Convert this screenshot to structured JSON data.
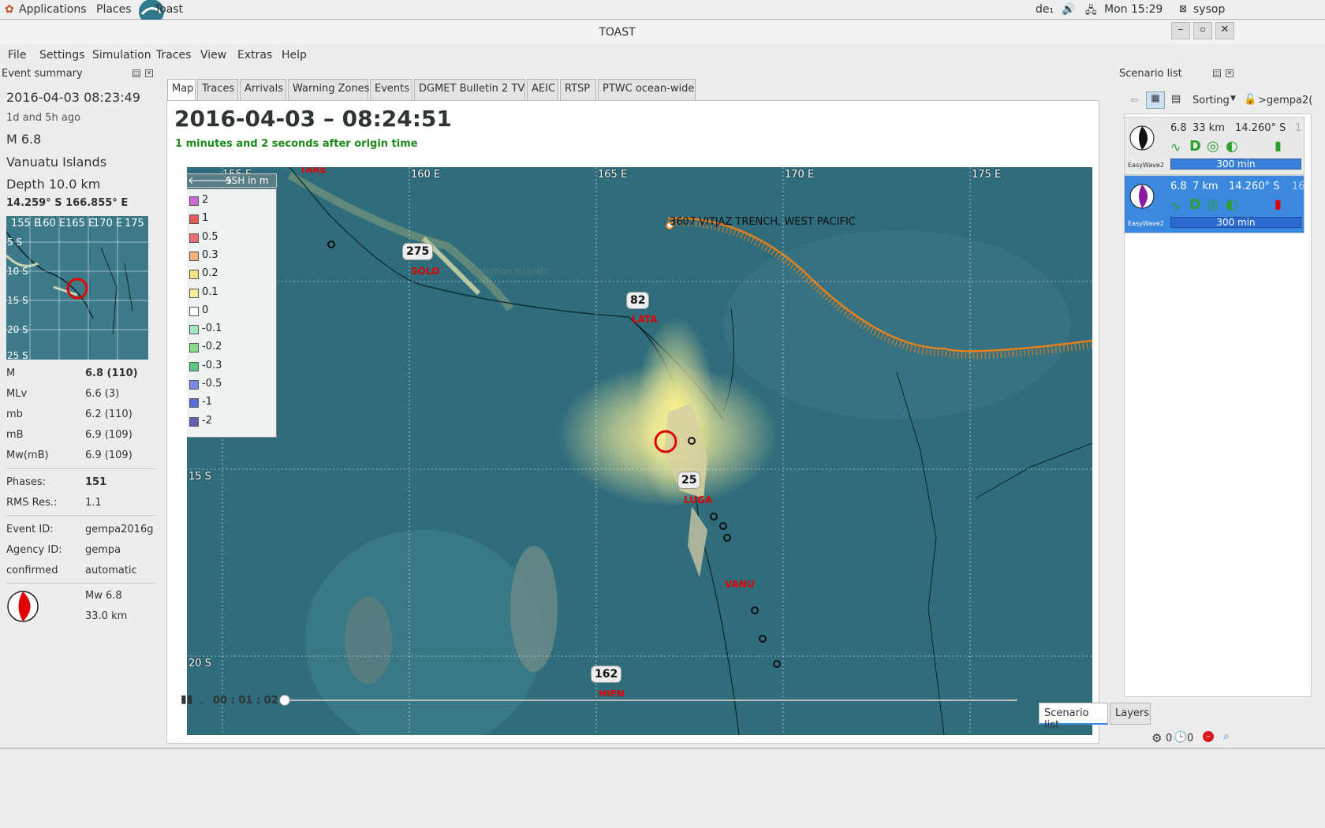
{
  "topbar": {
    "applications": "Applications",
    "places": "Places",
    "app_name": "Toast",
    "keyboard": "de₁",
    "clock": "Mon 15:29",
    "user": "sysop"
  },
  "window": {
    "title": "TOAST"
  },
  "menu": [
    "File",
    "Settings",
    "Simulation",
    "Traces",
    "View",
    "Extras",
    "Help"
  ],
  "event_summary": {
    "panel_title": "Event summary",
    "datetime": "2016-04-03 08:23:49",
    "ago": "1d and 5h ago",
    "magnitude": "M 6.8",
    "region": "Vanuatu Islands",
    "depth": "Depth 10.0 km",
    "coords": "14.259° S  166.855° E",
    "minimap_labels": [
      "155 E",
      "160 E",
      "165 E",
      "170 E",
      "175",
      "5 S",
      "10 S",
      "15 S",
      "20 S",
      "25 S"
    ],
    "magnitudes": [
      {
        "type": "M",
        "value": "6.8 (110)"
      },
      {
        "type": "MLv",
        "value": "6.6 (3)"
      },
      {
        "type": "mb",
        "value": "6.2 (110)"
      },
      {
        "type": "mB",
        "value": "6.9 (109)"
      },
      {
        "type": "Mw(mB)",
        "value": "6.9 (109)"
      }
    ],
    "phases_label": "Phases:",
    "phases": "151",
    "rms_label": "RMS Res.:",
    "rms": "1.1",
    "event_id_label": "Event ID:",
    "event_id": "gempa2016g",
    "agency_label": "Agency ID:",
    "agency": "gempa",
    "confirmed_label": "confirmed",
    "confirmed": "automatic",
    "mech_mw": "Mw 6.8",
    "mech_depth": "33.0 km"
  },
  "tabs": [
    "Map",
    "Traces",
    "Arrivals",
    "Warning Zones",
    "Events",
    "DGMET Bulletin 2 TV",
    "AEIC",
    "RTSP",
    "PTWC ocean-wide"
  ],
  "map": {
    "time_title": "2016-04-03 – 08:24:51",
    "time_subtitle": "1 minutes and 2 seconds after origin time",
    "legend_title": "SSH in m",
    "legend": [
      {
        "label": "2",
        "color": "#d266d2"
      },
      {
        "label": "1",
        "color": "#e85a5a"
      },
      {
        "label": "0.5",
        "color": "#ef6e6e"
      },
      {
        "label": "0.3",
        "color": "#f2b27a"
      },
      {
        "label": "0.2",
        "color": "#f2e07a"
      },
      {
        "label": "0.1",
        "color": "#f5ef9a"
      },
      {
        "label": "0",
        "color": "#ffffff"
      },
      {
        "label": "-0.1",
        "color": "#a8e8c0"
      },
      {
        "label": "-0.2",
        "color": "#86dc88"
      },
      {
        "label": "-0.3",
        "color": "#5cc880"
      },
      {
        "label": "-0.5",
        "color": "#7a88e8"
      },
      {
        "label": "-1",
        "color": "#5a6ad8"
      },
      {
        "label": "-2",
        "color": "#6060b0"
      }
    ],
    "grid_lon": [
      "155 E",
      "160 E",
      "165 E",
      "170 E",
      "175 E"
    ],
    "grid_lat": [
      "15 S",
      "20 S"
    ],
    "trench_label": "3607 VITJAZ TRENCH, WEST PACIFIC",
    "solomon_label": "Solomon Islands",
    "stations": [
      {
        "count": "275",
        "name": "SOLO"
      },
      {
        "count": "82",
        "name": "LATA"
      },
      {
        "count": "25",
        "name": "LUGA"
      },
      {
        "count": "162",
        "name": "HIEN"
      }
    ],
    "station_vanu": "VANU",
    "station_tare": "TARE",
    "lat_partial": "1"
  },
  "playback": {
    "time": "00 : 01 : 02"
  },
  "scenario": {
    "panel_title": "Scenario list",
    "sorting": "Sorting",
    "filter": ">gempa2(",
    "items": [
      {
        "mag": "6.8",
        "depth": "33 km",
        "lat": "14.260° S",
        "extra": "1",
        "model": "EasyWave2",
        "duration": "300 min"
      },
      {
        "mag": "6.8",
        "depth": "7 km",
        "lat": "14.260° S",
        "extra": "16",
        "model": "EasyWave2",
        "duration": "300 min"
      }
    ],
    "tab_list": "Scenario list",
    "tab_layers": "Layers"
  },
  "status": {
    "gear_count": "0",
    "clock_count": "0"
  }
}
